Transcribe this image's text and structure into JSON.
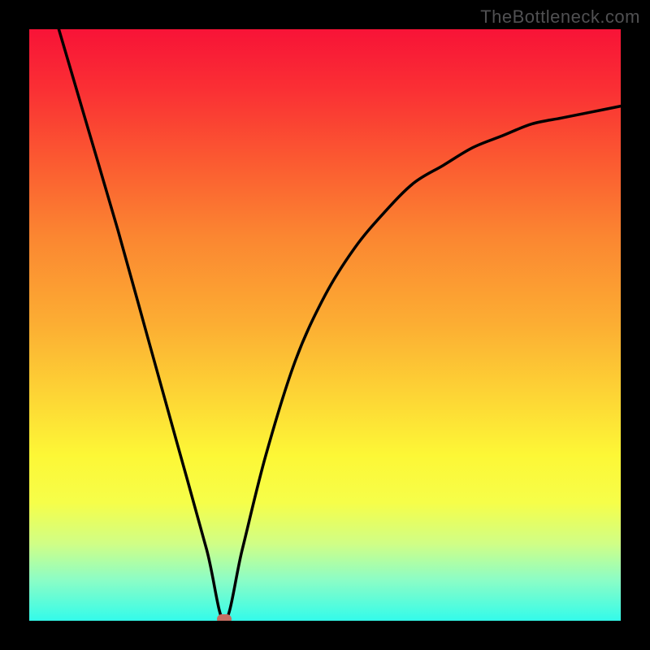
{
  "watermark": "TheBottleneck.com",
  "marker": {
    "color": "#c66e62"
  },
  "chart_data": {
    "type": "line",
    "title": "",
    "xlabel": "",
    "ylabel": "",
    "xlim": [
      0,
      100
    ],
    "ylim": [
      0,
      100
    ],
    "minimum_x": 33,
    "series": [
      {
        "name": "curve",
        "x": [
          5,
          10,
          15,
          20,
          25,
          30,
          33,
          36,
          40,
          45,
          50,
          55,
          60,
          65,
          70,
          75,
          80,
          85,
          90,
          95,
          100
        ],
        "y": [
          100,
          83,
          66,
          48,
          30,
          12,
          0,
          12,
          28,
          44,
          55,
          63,
          69,
          74,
          77,
          80,
          82,
          84,
          85,
          86,
          87
        ]
      }
    ]
  }
}
